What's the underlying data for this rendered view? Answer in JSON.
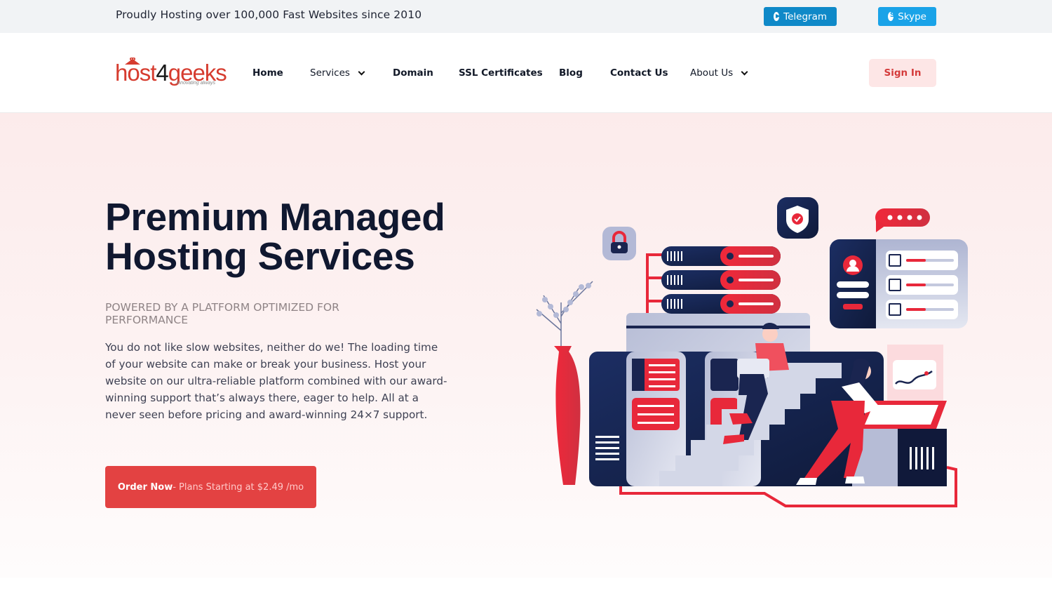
{
  "topbar": {
    "tagline": "Proudly Hosting over 100,000 Fast Websites since 2010",
    "social": [
      {
        "label": "Telegram",
        "icon": "telegram-icon",
        "color": "#0f89c8"
      },
      {
        "label": "Skype",
        "icon": "skype-icon",
        "color": "#1aa3e8"
      }
    ]
  },
  "header": {
    "logo": {
      "text_main": "host",
      "text_num": "4",
      "text_end": "geeks",
      "tagline": "innovating always"
    },
    "nav": [
      {
        "label": "Home",
        "dropdown": false
      },
      {
        "label": "Services",
        "dropdown": true
      },
      {
        "label": "Domain",
        "dropdown": false
      },
      {
        "label": "SSL Certificates",
        "dropdown": false
      },
      {
        "label": "Blog",
        "dropdown": false
      },
      {
        "label": "Contact Us",
        "dropdown": false
      },
      {
        "label": "About Us",
        "dropdown": true
      }
    ],
    "signin_label": "Sign In"
  },
  "hero": {
    "title": "Premium Managed Hosting Services",
    "subtitle": "POWERED BY A PLATFORM OPTIMIZED FOR PERFORMANCE",
    "description": "You do not like slow websites, neither do we! The loading time of your website can make or break your business. Host your website on our ultra-reliable platform combined with our award-winning support that’s always there, eager to help. All at a never seen before pricing and award-winning 24×7 support.",
    "cta": {
      "bold": "Order Now",
      "light": " - Plans Starting at $2.49 /mo"
    },
    "illustration": "server-hosting-illustration"
  },
  "colors": {
    "accent": "#e34242",
    "navy": "#17264f",
    "hero_bg": "#fcebeb",
    "signin_bg": "#fde6e6"
  }
}
